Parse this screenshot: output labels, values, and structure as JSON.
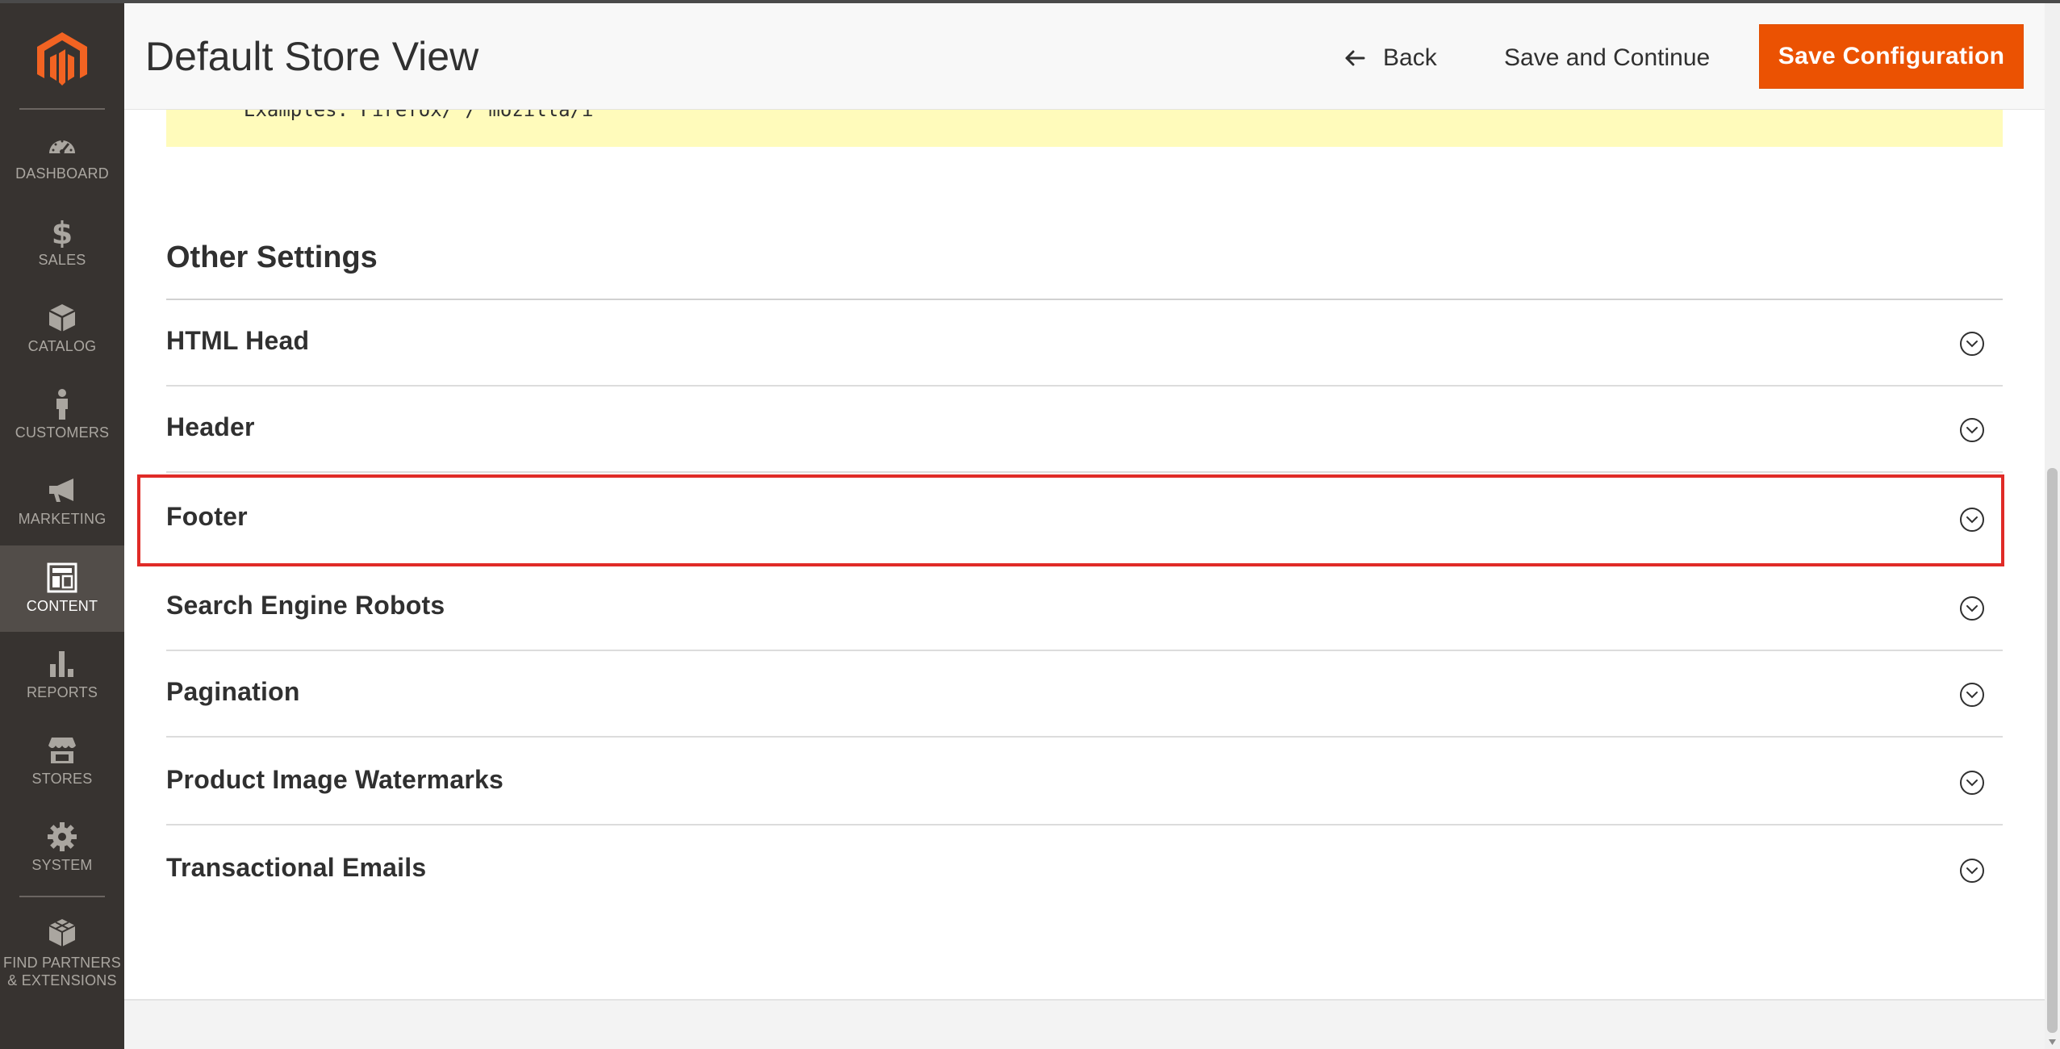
{
  "header": {
    "title": "Default Store View",
    "back_label": "Back",
    "save_continue_label": "Save and Continue",
    "save_config_label": "Save Configuration"
  },
  "sidebar": {
    "items": [
      {
        "label": "DASHBOARD",
        "icon": "dashboard-icon"
      },
      {
        "label": "SALES",
        "icon": "dollar-icon"
      },
      {
        "label": "CATALOG",
        "icon": "cube-icon"
      },
      {
        "label": "CUSTOMERS",
        "icon": "person-icon"
      },
      {
        "label": "MARKETING",
        "icon": "megaphone-icon"
      },
      {
        "label": "CONTENT",
        "icon": "layout-icon",
        "active": true
      },
      {
        "label": "REPORTS",
        "icon": "bar-chart-icon"
      },
      {
        "label": "STORES",
        "icon": "store-icon"
      },
      {
        "label": "SYSTEM",
        "icon": "gear-icon"
      },
      {
        "label": "FIND PARTNERS & EXTENSIONS",
        "label_line1": "FIND PARTNERS",
        "label_line2": "& EXTENSIONS",
        "icon": "blocks-icon"
      }
    ]
  },
  "note": {
    "text": "Examples: Firefox/ / mozilla/i"
  },
  "section": {
    "title": "Other Settings",
    "groups": [
      {
        "label": "HTML Head"
      },
      {
        "label": "Header"
      },
      {
        "label": "Footer",
        "highlighted": true
      },
      {
        "label": "Search Engine Robots"
      },
      {
        "label": "Pagination"
      },
      {
        "label": "Product Image Watermarks"
      },
      {
        "label": "Transactional Emails"
      }
    ]
  },
  "colors": {
    "accent": "#eb5202",
    "sidebar_bg": "#373330",
    "highlight": "#e02b27",
    "note_bg": "#fffbbb"
  }
}
